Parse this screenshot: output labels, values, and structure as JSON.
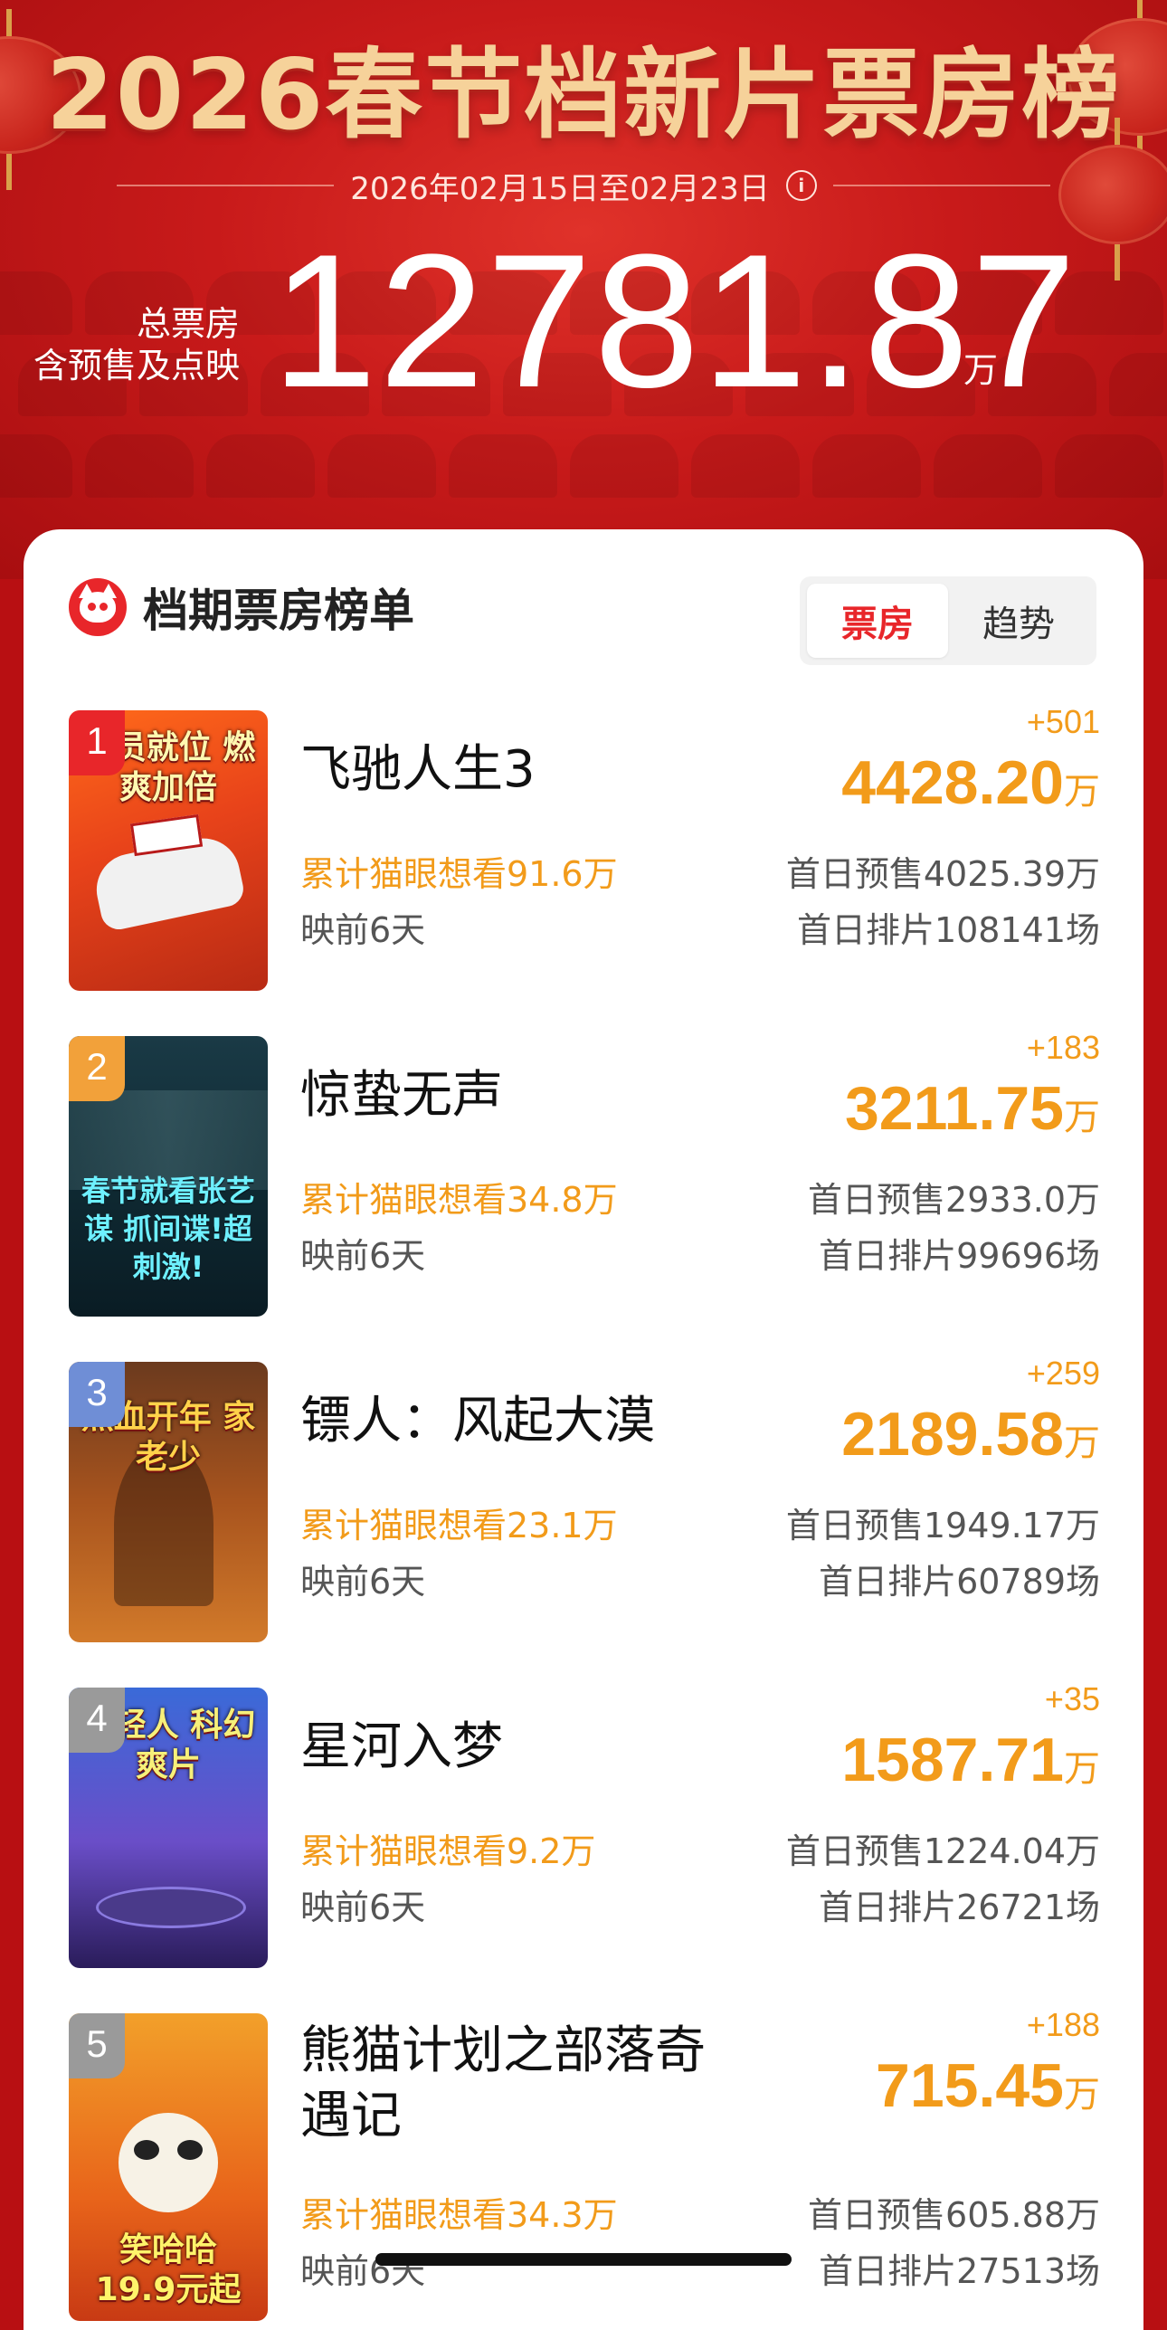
{
  "header": {
    "title": "2026春节档新片票房榜",
    "date_range": "2026年02月15日至02月23日",
    "info_icon": "i",
    "total_label_1": "总票房",
    "total_label_2": "含预售及点映",
    "total_value": "12781.87",
    "total_unit": "万"
  },
  "card": {
    "title": "档期票房榜单",
    "tabs": [
      {
        "label": "票房",
        "active": true
      },
      {
        "label": "趋势",
        "active": false
      }
    ]
  },
  "colors": {
    "accent_red": "#e8262a",
    "accent_orange": "#f29b1a",
    "rank_1": "#e8262a",
    "rank_2": "#f2a13a",
    "rank_3": "#6f8ed6",
    "rank_other": "#9a9a9a"
  },
  "movies": [
    {
      "rank": "1",
      "title": "飞驰人生3",
      "want": "累计猫眼想看91.6万",
      "days": "映前6天",
      "delta": "+501",
      "box": "4428.20",
      "box_unit": "万",
      "presale": "首日预售4025.39万",
      "shows": "首日排片108141场",
      "poster_text": "全员就位 燃爽加倍"
    },
    {
      "rank": "2",
      "title": "惊蛰无声",
      "want": "累计猫眼想看34.8万",
      "days": "映前6天",
      "delta": "+183",
      "box": "3211.75",
      "box_unit": "万",
      "presale": "首日预售2933.0万",
      "shows": "首日排片99696场",
      "poster_text": "春节就看张艺谋 抓间谍!超刺激!"
    },
    {
      "rank": "3",
      "title": "镖人：风起大漠",
      "want": "累计猫眼想看23.1万",
      "days": "映前6天",
      "delta": "+259",
      "box": "2189.58",
      "box_unit": "万",
      "presale": "首日预售1949.17万",
      "shows": "首日排片60789场",
      "poster_text": "热血开年 家老少"
    },
    {
      "rank": "4",
      "title": "星河入梦",
      "want": "累计猫眼想看9.2万",
      "days": "映前6天",
      "delta": "+35",
      "box": "1587.71",
      "box_unit": "万",
      "presale": "首日预售1224.04万",
      "shows": "首日排片26721场",
      "poster_text": "年轻人 科幻爽片"
    },
    {
      "rank": "5",
      "title": "熊猫计划之部落奇遇记",
      "want": "累计猫眼想看34.3万",
      "days": "映前6天",
      "delta": "+188",
      "box": "715.45",
      "box_unit": "万",
      "presale": "首日预售605.88万",
      "shows": "首日排片27513场",
      "poster_text": "笑哈哈 19.9元起"
    }
  ]
}
